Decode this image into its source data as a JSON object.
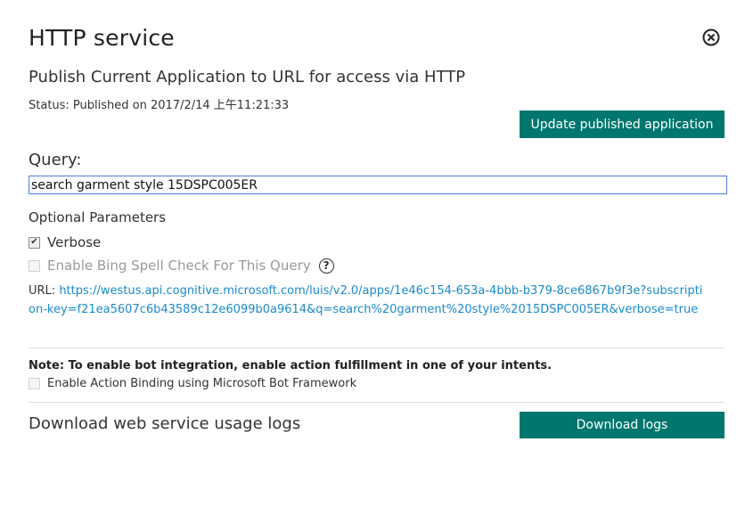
{
  "header": {
    "title": "HTTP service",
    "close_icon": "close-circle-icon"
  },
  "publish": {
    "subtitle": "Publish Current Application to URL for access via HTTP",
    "status": "Status: Published on 2017/2/14 上午11:21:33",
    "update_button": "Update published application"
  },
  "query": {
    "label": "Query:",
    "value": "search garment style 15DSPC005ER"
  },
  "options": {
    "title": "Optional Parameters",
    "verbose_label": "Verbose",
    "verbose_checked": true,
    "bing_label": "Enable Bing Spell Check For This Query",
    "bing_checked": false,
    "help_icon": "question-circle-icon"
  },
  "url": {
    "label": "URL: ",
    "link": "https://westus.api.cognitive.microsoft.com/luis/v2.0/apps/1e46c154-653a-4bbb-b379-8ce6867b9f3e?subscription-key=f21ea5607c6b43589c12e6099b0a9614&q=search%20garment%20style%2015DSPC005ER&verbose=true"
  },
  "bot": {
    "note": "Note: To enable bot integration, enable action fulfillment in one of your intents.",
    "action_binding_label": "Enable Action Binding using Microsoft Bot Framework",
    "action_binding_checked": false
  },
  "logs": {
    "label": "Download web service usage logs",
    "button": "Download logs"
  },
  "colors": {
    "accent": "#00776e",
    "link": "#1b8bc8",
    "input_border": "#4a7fdc"
  }
}
